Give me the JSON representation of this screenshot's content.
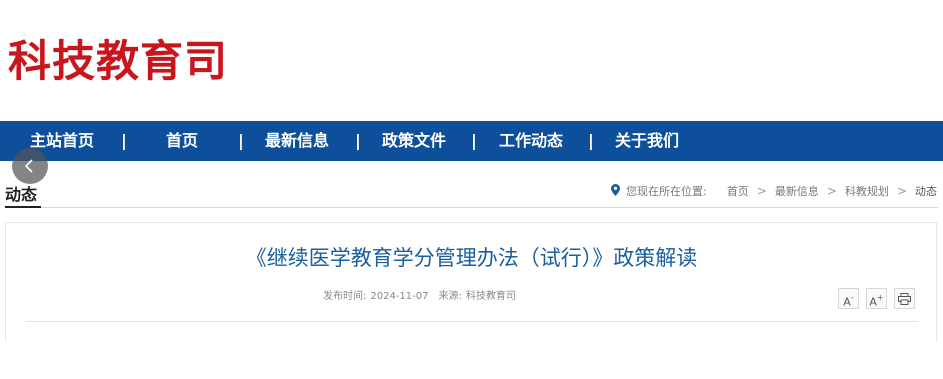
{
  "site": {
    "title": "科技教育司"
  },
  "nav": {
    "items": [
      {
        "label": "主站首页"
      },
      {
        "label": "首页"
      },
      {
        "label": "最新信息"
      },
      {
        "label": "政策文件"
      },
      {
        "label": "工作动态"
      },
      {
        "label": "关于我们"
      }
    ],
    "separator": "|"
  },
  "section": {
    "title": "动态"
  },
  "breadcrumb": {
    "prefix": "您现在所在位置:",
    "items": [
      {
        "label": "首页"
      },
      {
        "label": "最新信息"
      },
      {
        "label": "科教规划"
      },
      {
        "label": "动态"
      }
    ],
    "separator": ">"
  },
  "article": {
    "title": "《继续医学教育学分管理办法（试行）》政策解读",
    "publish_label": "发布时间:",
    "publish_date": "2024-11-07",
    "source_label": "来源:",
    "source": "科技教育司"
  },
  "tools": {
    "font_decrease": "A",
    "font_decrease_sign": "-",
    "font_increase": "A",
    "font_increase_sign": "+"
  },
  "colors": {
    "brand_red": "#c8161d",
    "nav_blue": "#0d4f9a",
    "headline_blue": "#1a5fa0"
  }
}
